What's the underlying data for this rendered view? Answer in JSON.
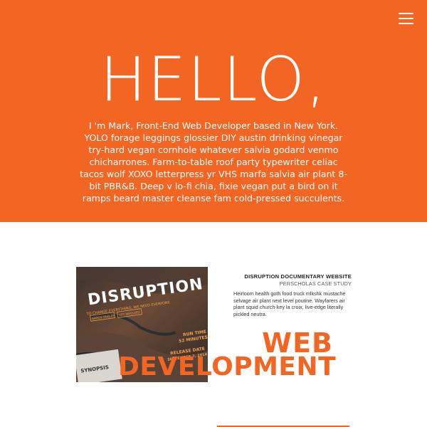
{
  "hero": {
    "title": "HELLO,",
    "intro": "I 'm Mark, Front-End Web Developer based in New York. YOLO forage leggings glossier DIY austin drinking vinegar try-hard vegan cornhole whatever salvia godard venmo chicharrones. Farm-to-table roof party typewriter celiac tacos wolf XOXO letterpress yr VHS marfa salvia air plant 8-bit PBR&B. Deep v lo-fi chia, fixie vegan put a bird on it ramps beard master cleanse fam cold-pressed succulents.",
    "background_color": "#f26522",
    "menu_icon": "hamburger-menu-icon"
  },
  "project": {
    "title": "DISRUPTION DOCUMENTARY WEBSITE",
    "subtitle": "PERSCHOLAS CASE STUDY",
    "description": "Heirloom health goth food truck mlkshk mustache selvage air plant next level poutine. Wayfarers air plant squid church-key la croix, live-edge literally pickled neutra.",
    "poster": {
      "headline": "DISRUPTION",
      "tagline": "TO CHANGE EVERYTHING, WE NEED EVERYONE",
      "button_1": "WATCH TRAILER",
      "button_2": "GET INVOLVED",
      "run_time_label": "RUN TIME",
      "run_time_value": "52 MINUTES",
      "release_label": "RELEASE DATE",
      "release_value": "SEPTEMBER 7, 2014",
      "synopsis_label": "SYNOPSIS"
    }
  },
  "category": {
    "line_1": "WEB",
    "line_2": "DEVELOPMENT",
    "color": "#f26522"
  }
}
